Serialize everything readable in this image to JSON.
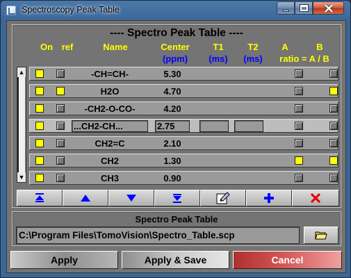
{
  "window": {
    "title": "Spectroscopy Peak Table",
    "title_color": "#3b6797",
    "close_color": "#cc5a3e"
  },
  "panel": {
    "title": "---- Spectro Peak Table ----",
    "headers": {
      "on": "On",
      "ref": "ref",
      "name": "Name",
      "center": "Center",
      "center_unit": "(ppm)",
      "t1": "T1",
      "t1_unit": "(ms)",
      "t2": "T2",
      "t2_unit": "(ms)",
      "a": "A",
      "b": "B",
      "ratio": "ratio = A / B"
    },
    "header_colors": {
      "yellow": "#ffff00",
      "blue": "#0000ff"
    }
  },
  "rows": [
    {
      "name": "-CH=CH-",
      "center": "5.30",
      "on": true,
      "ref": false,
      "a": false,
      "b": false,
      "selected": false
    },
    {
      "name": "H2O",
      "center": "4.70",
      "on": true,
      "ref": true,
      "a": false,
      "b": true,
      "selected": false
    },
    {
      "name": "-CH2-O-CO-",
      "center": "4.20",
      "on": true,
      "ref": false,
      "a": false,
      "b": false,
      "selected": false
    },
    {
      "name": "...CH2-CH...",
      "center": "2.75",
      "on": true,
      "ref": false,
      "a": false,
      "b": false,
      "selected": true
    },
    {
      "name": "CH2=C",
      "center": "2.10",
      "on": true,
      "ref": false,
      "a": false,
      "b": false,
      "selected": false
    },
    {
      "name": "CH2",
      "center": "1.30",
      "on": true,
      "ref": false,
      "a": true,
      "b": true,
      "selected": false
    },
    {
      "name": "CH3",
      "center": "0.90",
      "on": true,
      "ref": false,
      "a": false,
      "b": false,
      "selected": false
    }
  ],
  "toolbar": {
    "icons": [
      "move-top-icon",
      "move-up-icon",
      "move-down-icon",
      "move-bottom-icon",
      "edit-icon",
      "add-icon",
      "delete-icon"
    ]
  },
  "file": {
    "title": "Spectro Peak Table",
    "path": "C:\\Program Files\\TomoVision\\Spectro_Table.scp",
    "browse_icon": "folder-icon"
  },
  "buttons": {
    "apply": "Apply",
    "apply_save": "Apply & Save",
    "cancel": "Cancel"
  }
}
